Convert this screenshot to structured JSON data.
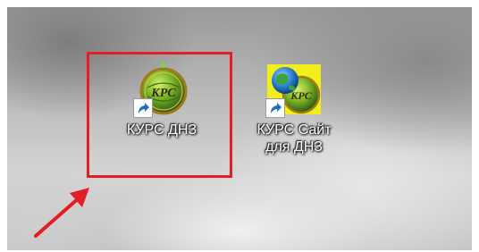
{
  "desktop": {
    "icons": [
      {
        "label": "КУРС ДНЗ",
        "icon": "kurs-dnz-globe-icon",
        "shortcut": true
      },
      {
        "label": "КУРС Сайт для ДНЗ",
        "label_lines": [
          "КУРС Сайт",
          "для ДНЗ"
        ],
        "icon": "kurs-site-globe-icon",
        "shortcut": true
      }
    ],
    "annotation": {
      "highlight_color": "#e41e26",
      "arrow_color": "#e41e26"
    }
  }
}
